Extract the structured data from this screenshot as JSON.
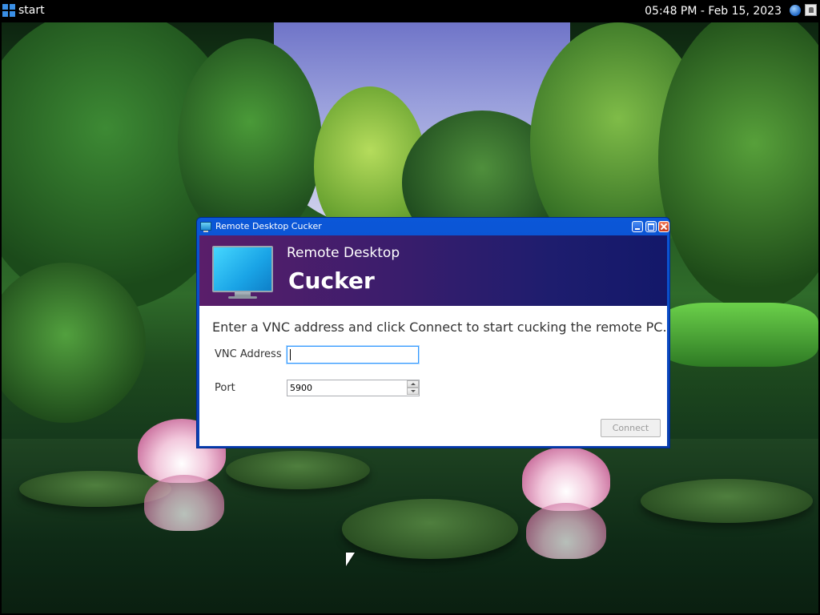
{
  "taskbar": {
    "start_label": "start",
    "clock": "05:48 PM - Feb 15, 2023",
    "tray_icons": [
      "globe-icon",
      "user-icon"
    ]
  },
  "window": {
    "title": "Remote Desktop Cucker",
    "banner_subtitle": "Remote Desktop",
    "banner_title": "Cucker",
    "instructions": "Enter a VNC address and click Connect to start cucking the remote PC.",
    "fields": {
      "address_label": "VNC Address",
      "address_value": "",
      "port_label": "Port",
      "port_value": "5900"
    },
    "connect_label": "Connect",
    "connect_enabled": false
  },
  "colors": {
    "titlebar": "#0b57d8",
    "banner_start": "#5a1e6a",
    "banner_end": "#13186a",
    "taskbar": "#000000"
  }
}
